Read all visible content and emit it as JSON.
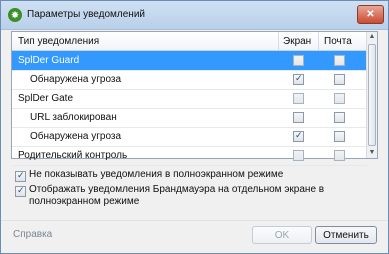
{
  "window": {
    "title": "Параметры уведомлений",
    "app_icon": "drweb-spider-icon",
    "close_glyph": "✕"
  },
  "table": {
    "columns": [
      "Тип уведомления",
      "Экран",
      "Почта"
    ],
    "rows": [
      {
        "label": "SplDer Guard",
        "indent": 0,
        "selected": true,
        "screen": null,
        "mail": null
      },
      {
        "label": "Обнаружена угроза",
        "indent": 1,
        "selected": false,
        "screen": true,
        "mail": false
      },
      {
        "label": "SplDer Gate",
        "indent": 0,
        "selected": false,
        "screen": null,
        "mail": null
      },
      {
        "label": "URL заблокирован",
        "indent": 1,
        "selected": false,
        "screen": false,
        "mail": false
      },
      {
        "label": "Обнаружена угроза",
        "indent": 1,
        "selected": false,
        "screen": true,
        "mail": false
      },
      {
        "label": "Родительский контроль",
        "indent": 0,
        "selected": false,
        "screen": null,
        "mail": null
      }
    ]
  },
  "options": [
    {
      "label": "Не показывать уведомления в полноэкранном режиме",
      "checked": true
    },
    {
      "label": "Отображать уведомления Брандмауэра на отдельном экране в полноэкранном режиме",
      "checked": true
    }
  ],
  "footer": {
    "help": "Справка",
    "ok": "OK",
    "cancel": "Отменить"
  }
}
